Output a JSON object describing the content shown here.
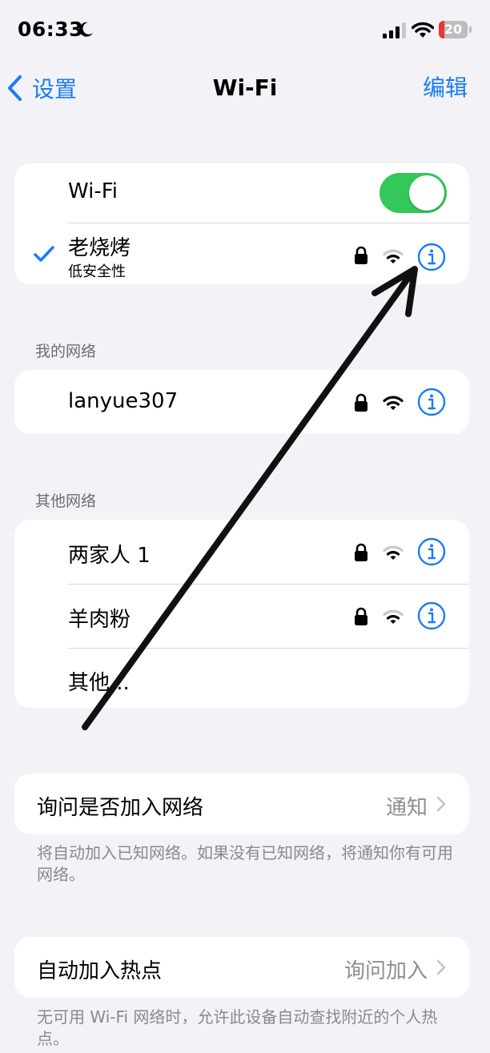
{
  "status_bar": {
    "time": "06:33",
    "battery": "20",
    "battery_level_percent": 20,
    "battery_color": "#e8392f"
  },
  "nav": {
    "back_label": "设置",
    "title": "Wi-Fi",
    "edit_label": "编辑"
  },
  "current": {
    "wifi_label": "Wi-Fi",
    "wifi_on": true,
    "network_name": "老烧烤",
    "network_subtitle": "低安全性"
  },
  "my_networks": {
    "header": "我的网络",
    "items": [
      {
        "name": "lanyue307"
      }
    ]
  },
  "other_networks": {
    "header": "其他网络",
    "items": [
      {
        "name": "两家人 1"
      },
      {
        "name": "羊肉粉"
      }
    ],
    "other_label": "其他..."
  },
  "ask_join": {
    "label": "询问是否加入网络",
    "value": "通知",
    "footnote": "将自动加入已知网络。如果没有已知网络，将通知你有可用网络。"
  },
  "auto_hotspot": {
    "label": "自动加入热点",
    "value": "询问加入",
    "footnote": "无可用 Wi-Fi 网络时，允许此设备自动查找附近的个人热点。"
  },
  "colors": {
    "accent": "#1a7cf5",
    "toggle_on": "#34c759",
    "background": "#f2f2f7"
  }
}
